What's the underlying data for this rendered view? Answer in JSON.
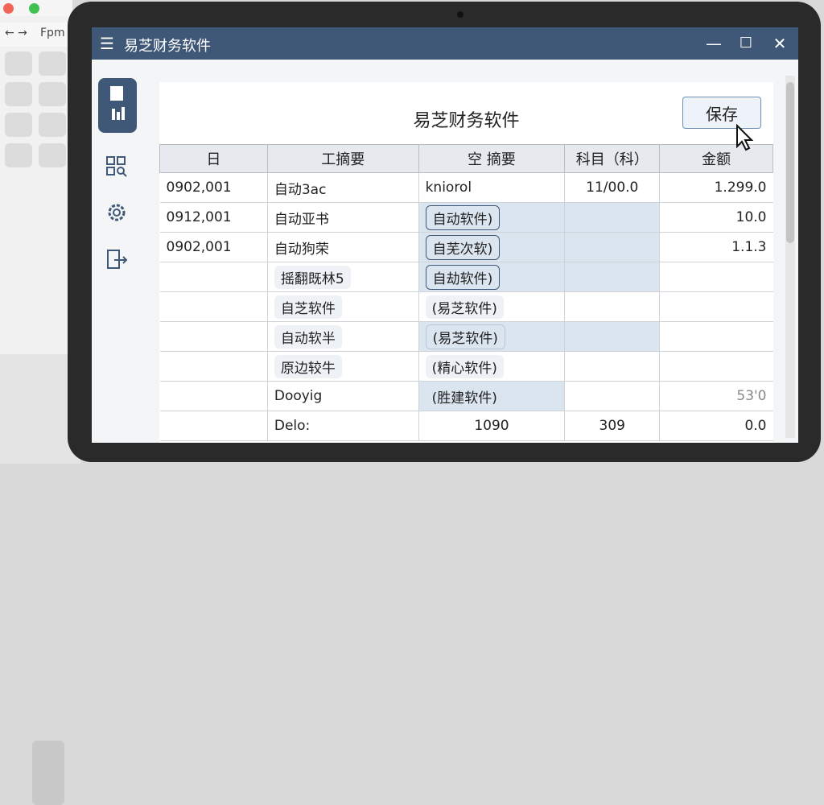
{
  "background": {
    "nav_text": "Fpm",
    "arrows": "← →"
  },
  "window": {
    "title": "易芝财务软件",
    "menu_icon": "hamburger-icon",
    "minimize_icon": "minimize-icon",
    "maximize_icon": "maximize-icon",
    "close_icon": "close-icon"
  },
  "sidebar": {
    "items": [
      {
        "icon": "document-chart-icon",
        "active": true
      },
      {
        "icon": "grid-search-icon",
        "active": false
      },
      {
        "icon": "gear-icon",
        "active": false
      },
      {
        "icon": "export-icon",
        "active": false
      }
    ]
  },
  "content": {
    "title": "易芝财务软件",
    "save_label": "保存",
    "columns": [
      "日",
      "工摘要",
      "空 摘要",
      "科目（科）",
      "金额"
    ],
    "rows": [
      {
        "date": "0902,001",
        "memo": "自动3ac",
        "summary": "kniorol",
        "subject": "11/00.0",
        "amount": "1.299.0"
      },
      {
        "date": "0912,001",
        "memo": "自动亚书",
        "summary": "自动软件)",
        "subject": "",
        "amount": "10.0"
      },
      {
        "date": "0902,001",
        "memo": "自动狗荣",
        "summary": "自芜次软)",
        "subject": "",
        "amount": "1.1.3"
      },
      {
        "date": "",
        "memo": "摇翻既林5",
        "summary": "自劫软件)",
        "subject": "",
        "amount": ""
      },
      {
        "date": "",
        "memo": "自芝软件",
        "summary": "(易芝软件)",
        "subject": "",
        "amount": ""
      },
      {
        "date": "",
        "memo": "自动软半",
        "summary": "(易芝软件)",
        "subject": "",
        "amount": ""
      },
      {
        "date": "",
        "memo": "原边较牛",
        "summary": "(精心软件)",
        "subject": "",
        "amount": ""
      },
      {
        "date": "",
        "memo": "Dooyig",
        "summary": "(胜建软件)",
        "subject": "",
        "amount": "53'0"
      },
      {
        "date": "",
        "memo": "Delo:",
        "summary": "1090",
        "subject": "309",
        "amount": "0.0"
      }
    ]
  }
}
